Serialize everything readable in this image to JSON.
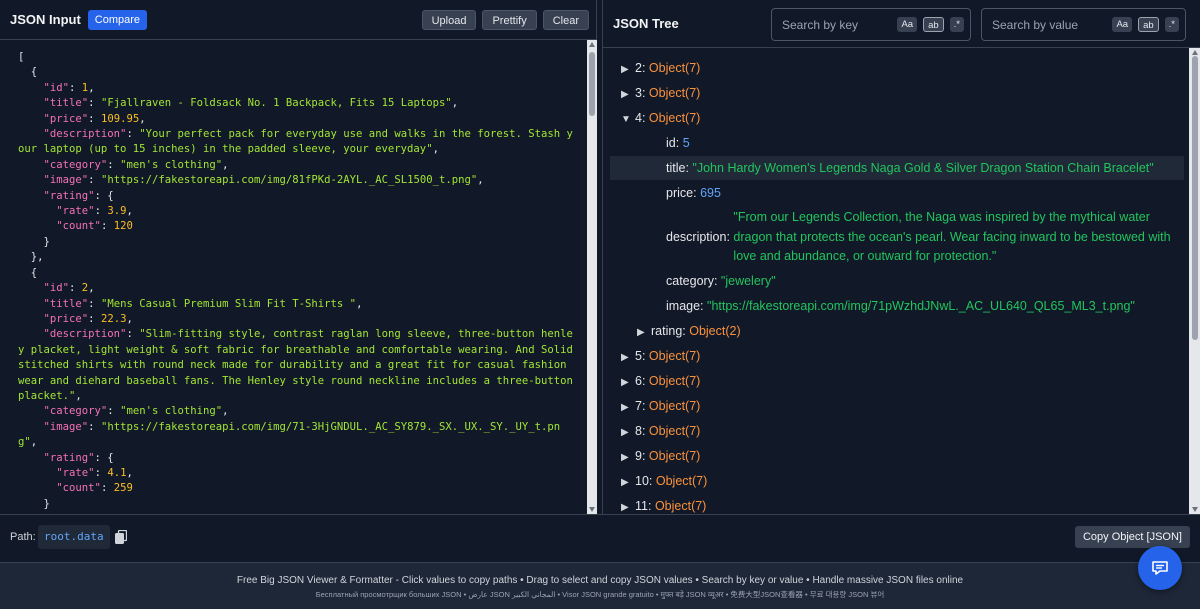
{
  "left": {
    "title": "JSON Input",
    "compare": "Compare",
    "buttons": {
      "upload": "Upload",
      "prettify": "Prettify",
      "clear": "Clear"
    },
    "code_lines": [
      [
        {
          "t": "p",
          "v": "["
        }
      ],
      [
        {
          "t": "p",
          "v": "  {"
        }
      ],
      [
        {
          "t": "p",
          "v": "    "
        },
        {
          "t": "k",
          "v": "\"id\""
        },
        {
          "t": "p",
          "v": ": "
        },
        {
          "t": "n",
          "v": "1"
        },
        {
          "t": "p",
          "v": ","
        }
      ],
      [
        {
          "t": "p",
          "v": "    "
        },
        {
          "t": "k",
          "v": "\"title\""
        },
        {
          "t": "p",
          "v": ": "
        },
        {
          "t": "s",
          "v": "\"Fjallraven - Foldsack No. 1 Backpack, Fits 15 Laptops\""
        },
        {
          "t": "p",
          "v": ","
        }
      ],
      [
        {
          "t": "p",
          "v": "    "
        },
        {
          "t": "k",
          "v": "\"price\""
        },
        {
          "t": "p",
          "v": ": "
        },
        {
          "t": "n",
          "v": "109.95"
        },
        {
          "t": "p",
          "v": ","
        }
      ],
      [
        {
          "t": "p",
          "v": "    "
        },
        {
          "t": "k",
          "v": "\"description\""
        },
        {
          "t": "p",
          "v": ": "
        },
        {
          "t": "s",
          "v": "\"Your perfect pack for everyday use and walks in the forest. Stash your laptop (up to 15 inches) in the padded sleeve, your everyday\""
        },
        {
          "t": "p",
          "v": ","
        }
      ],
      [
        {
          "t": "p",
          "v": "    "
        },
        {
          "t": "k",
          "v": "\"category\""
        },
        {
          "t": "p",
          "v": ": "
        },
        {
          "t": "s",
          "v": "\"men's clothing\""
        },
        {
          "t": "p",
          "v": ","
        }
      ],
      [
        {
          "t": "p",
          "v": "    "
        },
        {
          "t": "k",
          "v": "\"image\""
        },
        {
          "t": "p",
          "v": ": "
        },
        {
          "t": "s",
          "v": "\"https://fakestoreapi.com/img/81fPKd-2AYL._AC_SL1500_t.png\""
        },
        {
          "t": "p",
          "v": ","
        }
      ],
      [
        {
          "t": "p",
          "v": "    "
        },
        {
          "t": "k",
          "v": "\"rating\""
        },
        {
          "t": "p",
          "v": ": {"
        }
      ],
      [
        {
          "t": "p",
          "v": "      "
        },
        {
          "t": "k",
          "v": "\"rate\""
        },
        {
          "t": "p",
          "v": ": "
        },
        {
          "t": "n",
          "v": "3.9"
        },
        {
          "t": "p",
          "v": ","
        }
      ],
      [
        {
          "t": "p",
          "v": "      "
        },
        {
          "t": "k",
          "v": "\"count\""
        },
        {
          "t": "p",
          "v": ": "
        },
        {
          "t": "n",
          "v": "120"
        }
      ],
      [
        {
          "t": "p",
          "v": "    }"
        }
      ],
      [
        {
          "t": "p",
          "v": "  },"
        }
      ],
      [
        {
          "t": "p",
          "v": "  {"
        }
      ],
      [
        {
          "t": "p",
          "v": "    "
        },
        {
          "t": "k",
          "v": "\"id\""
        },
        {
          "t": "p",
          "v": ": "
        },
        {
          "t": "n",
          "v": "2"
        },
        {
          "t": "p",
          "v": ","
        }
      ],
      [
        {
          "t": "p",
          "v": "    "
        },
        {
          "t": "k",
          "v": "\"title\""
        },
        {
          "t": "p",
          "v": ": "
        },
        {
          "t": "s",
          "v": "\"Mens Casual Premium Slim Fit T-Shirts \""
        },
        {
          "t": "p",
          "v": ","
        }
      ],
      [
        {
          "t": "p",
          "v": "    "
        },
        {
          "t": "k",
          "v": "\"price\""
        },
        {
          "t": "p",
          "v": ": "
        },
        {
          "t": "n",
          "v": "22.3"
        },
        {
          "t": "p",
          "v": ","
        }
      ],
      [
        {
          "t": "p",
          "v": "    "
        },
        {
          "t": "k",
          "v": "\"description\""
        },
        {
          "t": "p",
          "v": ": "
        },
        {
          "t": "s",
          "v": "\"Slim-fitting style, contrast raglan long sleeve, three-button henley placket, light weight & soft fabric for breathable and comfortable wearing. And Solid stitched shirts with round neck made for durability and a great fit for casual fashion wear and diehard baseball fans. The Henley style round neckline includes a three-button placket.\""
        },
        {
          "t": "p",
          "v": ","
        }
      ],
      [
        {
          "t": "p",
          "v": "    "
        },
        {
          "t": "k",
          "v": "\"category\""
        },
        {
          "t": "p",
          "v": ": "
        },
        {
          "t": "s",
          "v": "\"men's clothing\""
        },
        {
          "t": "p",
          "v": ","
        }
      ],
      [
        {
          "t": "p",
          "v": "    "
        },
        {
          "t": "k",
          "v": "\"image\""
        },
        {
          "t": "p",
          "v": ": "
        },
        {
          "t": "s",
          "v": "\"https://fakestoreapi.com/img/71-3HjGNDUL._AC_SY879._SX._UX._SY._UY_t.png\""
        },
        {
          "t": "p",
          "v": ","
        }
      ],
      [
        {
          "t": "p",
          "v": "    "
        },
        {
          "t": "k",
          "v": "\"rating\""
        },
        {
          "t": "p",
          "v": ": {"
        }
      ],
      [
        {
          "t": "p",
          "v": "      "
        },
        {
          "t": "k",
          "v": "\"rate\""
        },
        {
          "t": "p",
          "v": ": "
        },
        {
          "t": "n",
          "v": "4.1"
        },
        {
          "t": "p",
          "v": ","
        }
      ],
      [
        {
          "t": "p",
          "v": "      "
        },
        {
          "t": "k",
          "v": "\"count\""
        },
        {
          "t": "p",
          "v": ": "
        },
        {
          "t": "n",
          "v": "259"
        }
      ],
      [
        {
          "t": "p",
          "v": "    }"
        }
      ],
      [
        {
          "t": "p",
          "v": "  },"
        }
      ],
      [
        {
          "t": "p",
          "v": "  {"
        }
      ]
    ]
  },
  "right": {
    "title": "JSON Tree",
    "search_key": {
      "placeholder": "Search by key",
      "opts": [
        "Aa",
        "ab",
        ".*"
      ]
    },
    "search_value": {
      "placeholder": "Search by value",
      "opts": [
        "Aa",
        "ab",
        ".*"
      ]
    },
    "tree": [
      {
        "tri": "▶",
        "key": "2:",
        "obj": "Object(7)"
      },
      {
        "tri": "▶",
        "key": "3:",
        "obj": "Object(7)"
      },
      {
        "tri": "▼",
        "key": "4:",
        "obj": "Object(7)"
      },
      {
        "key": "id:",
        "num": "5"
      },
      {
        "key": "title:",
        "str": "\"John Hardy Women's Legends Naga Gold & Silver Dragon Station Chain Bracelet\"",
        "hl": true
      },
      {
        "key": "price:",
        "num": "695"
      },
      {
        "key": "description:",
        "str_lines": [
          "\"From our Legends Collection, the Naga was inspired by the mythical water",
          "dragon that protects the ocean's pearl. Wear facing inward to be bestowed with",
          "love and abundance, or outward for protection.\""
        ]
      },
      {
        "key": "category:",
        "str": "\"jewelery\""
      },
      {
        "key": "image:",
        "str": "\"https://fakestoreapi.com/img/71pWzhdJNwL._AC_UL640_QL65_ML3_t.png\""
      },
      {
        "tri": "▶",
        "key": "rating:",
        "obj": "Object(2)"
      },
      {
        "tri": "▶",
        "key": "5:",
        "obj": "Object(7)"
      },
      {
        "tri": "▶",
        "key": "6:",
        "obj": "Object(7)"
      },
      {
        "tri": "▶",
        "key": "7:",
        "obj": "Object(7)"
      },
      {
        "tri": "▶",
        "key": "8:",
        "obj": "Object(7)"
      },
      {
        "tri": "▶",
        "key": "9:",
        "obj": "Object(7)"
      },
      {
        "tri": "▶",
        "key": "10:",
        "obj": "Object(7)"
      },
      {
        "tri": "▶",
        "key": "11:",
        "obj": "Object(7)"
      }
    ]
  },
  "pathbar": {
    "label": "Path:",
    "value": "root.data",
    "copy_object": "Copy Object [JSON]"
  },
  "footer": {
    "line1": "Free Big JSON Viewer & Formatter - Click values to copy paths • Drag to select and copy JSON values • Search by key or value • Handle massive JSON files online",
    "line2": "Бесплатный просмотрщик больших JSON • عارض JSON المجاني الكبير • Visor JSON grande gratuito • मुफ्त बड़े JSON व्यूअर • 免费大型JSON查看器 • 무료 대용량 JSON 뷰어"
  },
  "colors": {
    "accent": "#2563eb",
    "key": "#f472b6",
    "string": "#a3e635",
    "number": "#fbbf24",
    "tree_obj": "#fb923c",
    "tree_str": "#22c55e",
    "tree_num": "#60a5fa"
  },
  "icons": [
    "copy-icon",
    "chat-icon",
    "expand-triangle-icon",
    "collapse-triangle-icon"
  ]
}
